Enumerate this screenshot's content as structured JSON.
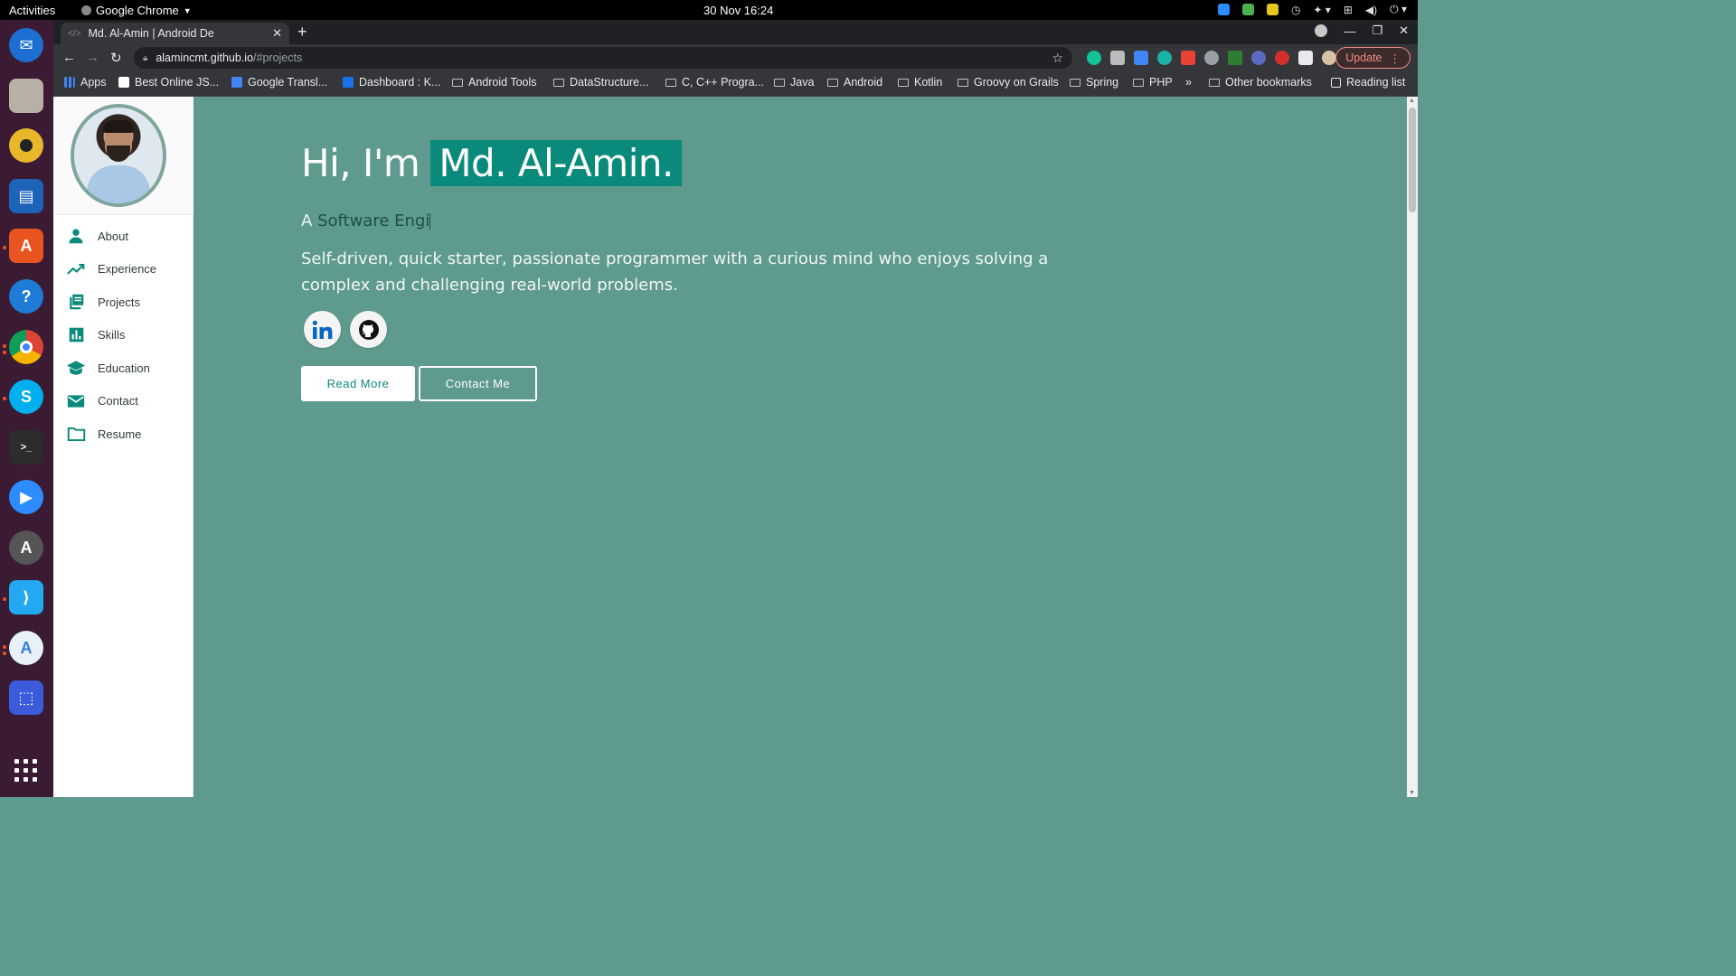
{
  "os": {
    "activities": "Activities",
    "app_menu": "Google Chrome",
    "clock": "30 Nov  16:24"
  },
  "browser": {
    "tab_title": "Md. Al-Amin | Android De",
    "url_host": "alamincmt.github.io",
    "url_path": "/#projects",
    "update_label": "Update",
    "bookmarks": [
      {
        "label": "Apps",
        "kind": "apps"
      },
      {
        "label": "Best Online JS...",
        "kind": "site"
      },
      {
        "label": "Google Transl...",
        "kind": "site"
      },
      {
        "label": "Dashboard : K...",
        "kind": "site"
      },
      {
        "label": "Android Tools",
        "kind": "folder"
      },
      {
        "label": "DataStructure...",
        "kind": "folder"
      },
      {
        "label": "C, C++ Progra...",
        "kind": "folder"
      },
      {
        "label": "Java",
        "kind": "folder"
      },
      {
        "label": "Android",
        "kind": "folder"
      },
      {
        "label": "Kotlin",
        "kind": "folder"
      },
      {
        "label": "Groovy on Grails",
        "kind": "folder"
      },
      {
        "label": "Spring",
        "kind": "folder"
      },
      {
        "label": "PHP",
        "kind": "folder"
      }
    ],
    "more_bookmarks": "»",
    "other_bookmarks": "Other bookmarks",
    "reading_list": "Reading list"
  },
  "sidebar": {
    "items": [
      {
        "label": "About",
        "icon": "person-icon"
      },
      {
        "label": "Experience",
        "icon": "trending-up-icon"
      },
      {
        "label": "Projects",
        "icon": "library-books-icon"
      },
      {
        "label": "Skills",
        "icon": "bar-chart-icon"
      },
      {
        "label": "Education",
        "icon": "graduation-cap-icon"
      },
      {
        "label": "Contact",
        "icon": "mail-icon"
      },
      {
        "label": "Resume",
        "icon": "folder-icon"
      }
    ]
  },
  "hero": {
    "greeting": "Hi, I'm",
    "name": "Md. Al-Amin.",
    "sub_prefix": "A",
    "sub_typed": "Software Engi",
    "description": "Self-driven, quick starter, passionate programmer with a curious mind who enjoys solving a complex and challenging real-world problems.",
    "read_more": "Read More",
    "contact_me": "Contact Me"
  },
  "colors": {
    "page_bg": "#5e9a8d",
    "accent": "#0a8a7a",
    "dock_bg": "#3a1b33"
  }
}
